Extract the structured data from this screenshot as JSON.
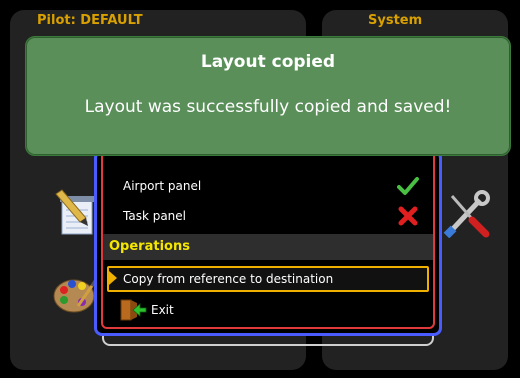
{
  "pilot_panel": {
    "title": "Pilot: DEFAULT"
  },
  "system_panel": {
    "title": "System"
  },
  "dialog": {
    "items": [
      {
        "label": "Airport panel",
        "status": "enabled"
      },
      {
        "label": "Task panel",
        "status": "disabled"
      }
    ],
    "section_title": "Operations",
    "operations": [
      {
        "label": "Copy from reference to destination"
      },
      {
        "label": "Exit"
      }
    ]
  },
  "toast": {
    "title": "Layout copied",
    "message": "Layout was successfully copied and saved!"
  },
  "colors": {
    "accent_orange": "#d8a000",
    "section_yellow": "#f5e600",
    "toast_green": "#5a8f5a",
    "check_green": "#49c043",
    "cross_red": "#e02020"
  }
}
